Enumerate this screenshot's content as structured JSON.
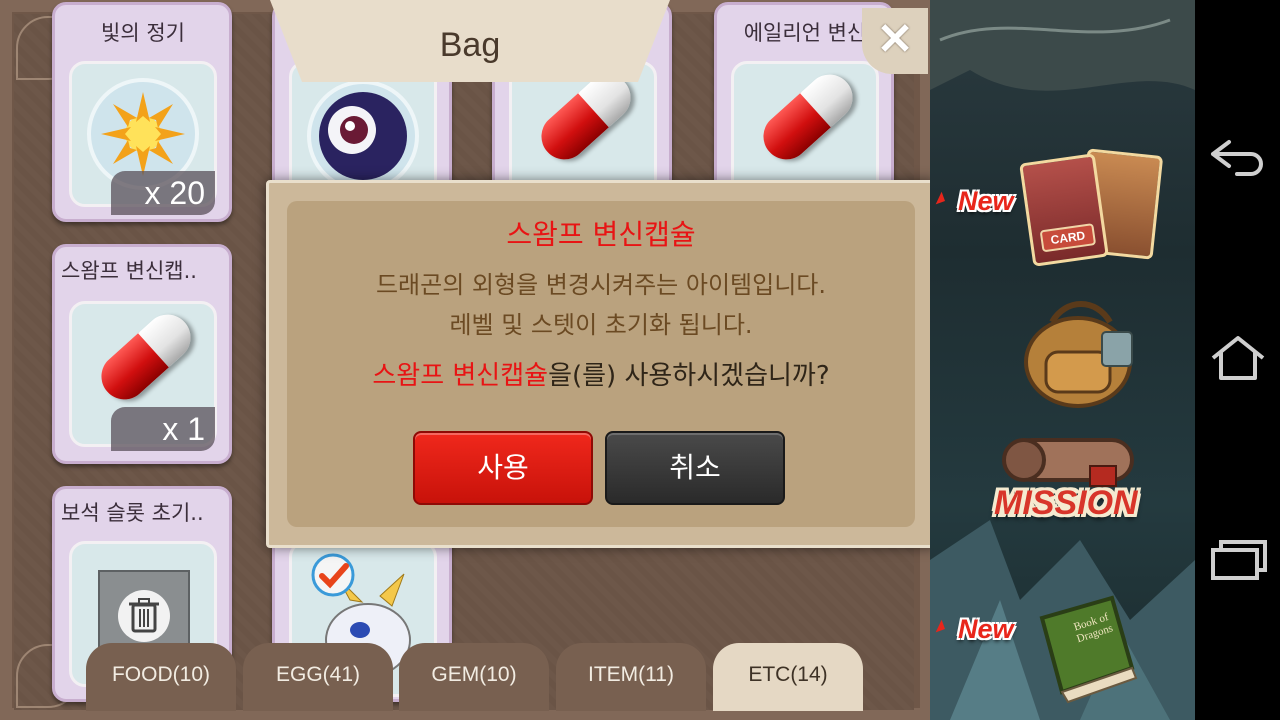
{
  "bag": {
    "title": "Bag",
    "close_label": "✕",
    "slots": [
      {
        "name": "빛의 정기",
        "qty": "x 20"
      },
      {
        "name": "",
        "qty": ""
      },
      {
        "name": "",
        "qty": ""
      },
      {
        "name": "에일리언 변신",
        "qty": ""
      },
      {
        "name": "스왐프 변신캡..",
        "qty": "x 1"
      },
      {
        "name": "보석 슬롯 초기..",
        "qty": ""
      },
      {
        "name": "",
        "qty": ""
      }
    ],
    "tabs": [
      {
        "label": "FOOD(10)"
      },
      {
        "label": "EGG(41)"
      },
      {
        "label": "GEM(10)"
      },
      {
        "label": "ITEM(11)"
      },
      {
        "label": "ETC(14)"
      }
    ],
    "active_tab": "ETC(14)"
  },
  "modal": {
    "title": "스왐프 변신캡슐",
    "desc_line1": "드래곤의 외형을 변경시켜주는 아이템입니다.",
    "desc_line2": "레벨 및 스텟이 초기화 됩니다.",
    "question_item": "스왐프 변신캡슐",
    "question_rest": "을(를) 사용하시겠습니까?",
    "use_label": "사용",
    "cancel_label": "취소"
  },
  "side": {
    "new_label_1": "New",
    "new_label_2": "New",
    "card_label": "CARD",
    "mission_label": "MISSION",
    "book_title": "Book of Dragons"
  },
  "nav": {
    "icons": [
      "back-icon",
      "home-icon",
      "recent-apps-icon"
    ]
  },
  "colors": {
    "modal_highlight": "#e81414",
    "use_button": "#e01e14",
    "cancel_button": "#333333",
    "active_tab": "#e5d8c4"
  }
}
